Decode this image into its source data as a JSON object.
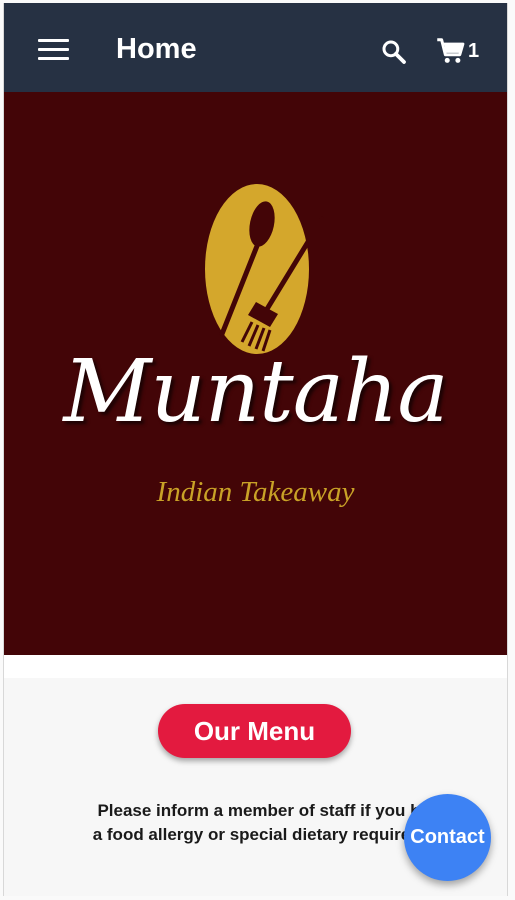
{
  "app_bar": {
    "title": "Home",
    "menu_icon": "hamburger-menu-icon",
    "search_icon": "search-icon",
    "cart_icon": "cart-icon",
    "cart_count": "1",
    "background": "#263143"
  },
  "hero": {
    "background": "#430507",
    "logo_icon": "spoon-and-fork-icon",
    "brand_name": "Muntaha",
    "tagline": "Indian Takeaway",
    "accent": "#c9a227"
  },
  "main": {
    "menu_button_label": "Our Menu",
    "menu_button_color": "#e31a3f",
    "notice_line1": "Please inform a member of staff if you h",
    "notice_line2": "a food allergy or special dietary requirem"
  },
  "fab": {
    "label": "Contact",
    "color": "#3d82f4"
  }
}
